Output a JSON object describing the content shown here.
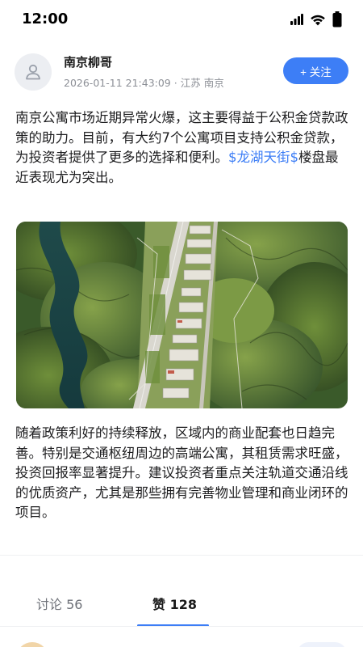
{
  "status_bar": {
    "time": "12:00",
    "icons": [
      "signal-icon",
      "wifi-icon",
      "battery-icon"
    ]
  },
  "post": {
    "author": {
      "name": "南京柳哥",
      "timestamp": "2026-01-11 21:43:09",
      "separator": "·",
      "location": "江苏 南京",
      "avatar_icon": "user-icon"
    },
    "follow_button": {
      "label": "+ 关注"
    },
    "paragraph1": {
      "text": "南京公寓市场近期异常火爆，这主要得益于公积金贷款政策的助力。目前，有大约7个公寓项目支持公积金贷款，为投资者提供了更多的选择和便利。",
      "stock_link": "$龙湖天街$",
      "text_after_link": "楼盘最近表现尤为突出。"
    },
    "image": {
      "subject": "aerial-view-of-valley-road-and-buildings"
    },
    "paragraph2": {
      "text": "随着政策利好的持续释放，区域内的商业配套也日趋完善。特别是交通枢纽周边的高端公寓，其租赁需求旺盛，投资回报率显著提升。建议投资者重点关注轨道交通沿线的优质资产，尤其是那些拥有完善物业管理和商业闭环的项目。"
    }
  },
  "tabs": [
    {
      "label": "讨论",
      "count": "56",
      "active": false
    },
    {
      "label": "赞",
      "count": "128",
      "active": true
    }
  ],
  "colors": {
    "accent": "#3d7ef6",
    "muted_text": "#8c8f96",
    "body_text": "#1d1d1f"
  }
}
